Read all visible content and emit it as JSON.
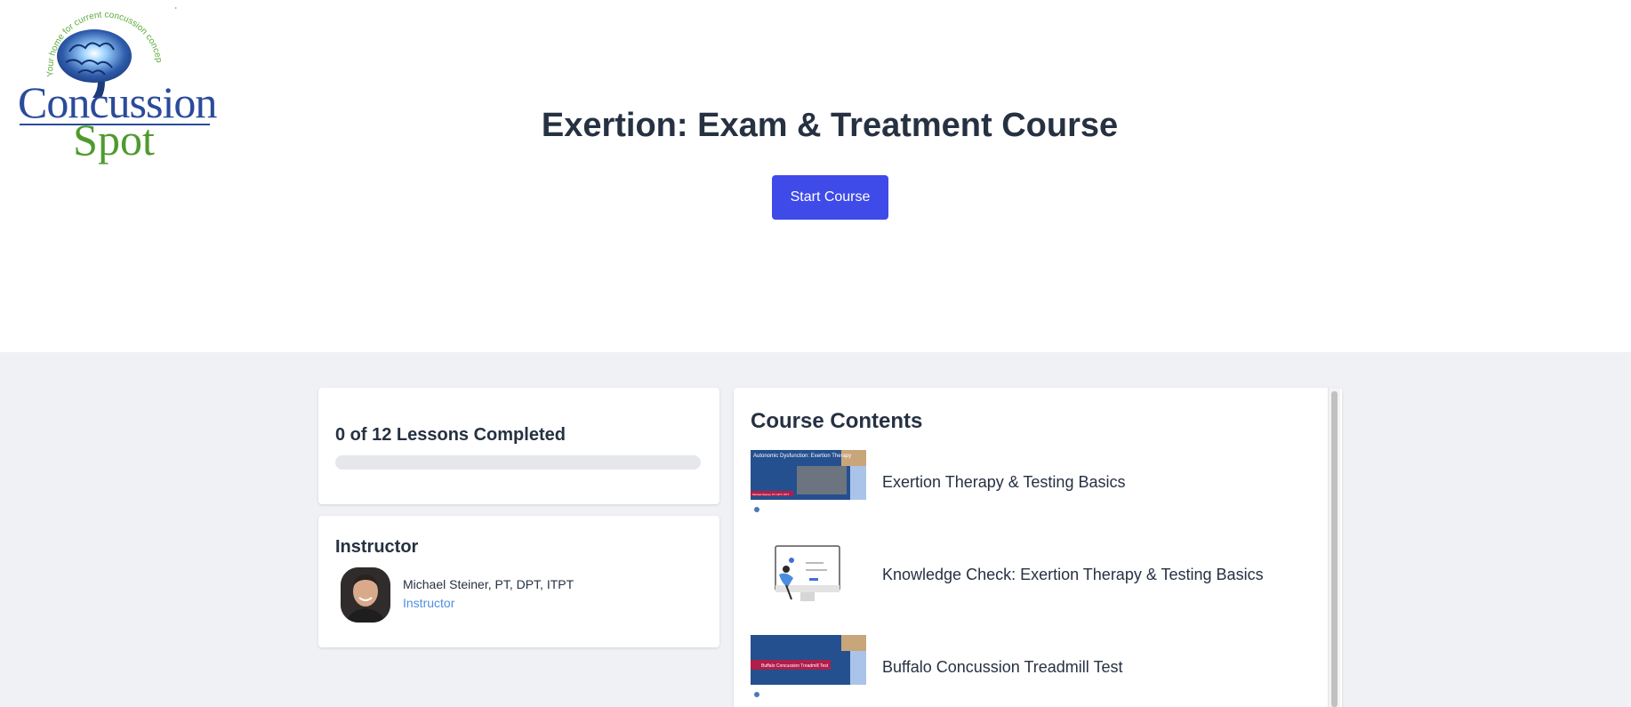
{
  "header": {
    "logo": {
      "line1": "Concussion",
      "line2": "Spot",
      "tagline": "Your home for current concussion concepts"
    },
    "course_title": "Exertion: Exam & Treatment Course",
    "start_button": "Start Course"
  },
  "progress": {
    "label": "0 of 12 Lessons Completed",
    "completed": 0,
    "total": 12,
    "fraction": 0
  },
  "instructor": {
    "heading": "Instructor",
    "name": "Michael Steiner, PT, DPT, ITPT",
    "role": "Instructor"
  },
  "contents": {
    "heading": "Course Contents",
    "lessons": [
      {
        "title": "Exertion Therapy & Testing Basics",
        "thumb_text": "Autonomic Dysfunction: Exertion Therapy",
        "thumb_caption": "Michael Steiner, PT, DPT, ITPT"
      },
      {
        "title": "Knowledge Check: Exertion Therapy & Testing Basics"
      },
      {
        "title": "Buffalo Concussion Treadmill Test",
        "thumb_text": "Buffalo Concussion Treadmill Test"
      }
    ]
  },
  "colors": {
    "accent": "#3f4be8",
    "logo_blue": "#2a4b9b",
    "logo_green": "#4f9a2e",
    "link": "#4f8fe0",
    "page_bg_lower": "#f0f1f5",
    "slide_blue": "#25508f",
    "slide_red": "#b01e4a"
  }
}
